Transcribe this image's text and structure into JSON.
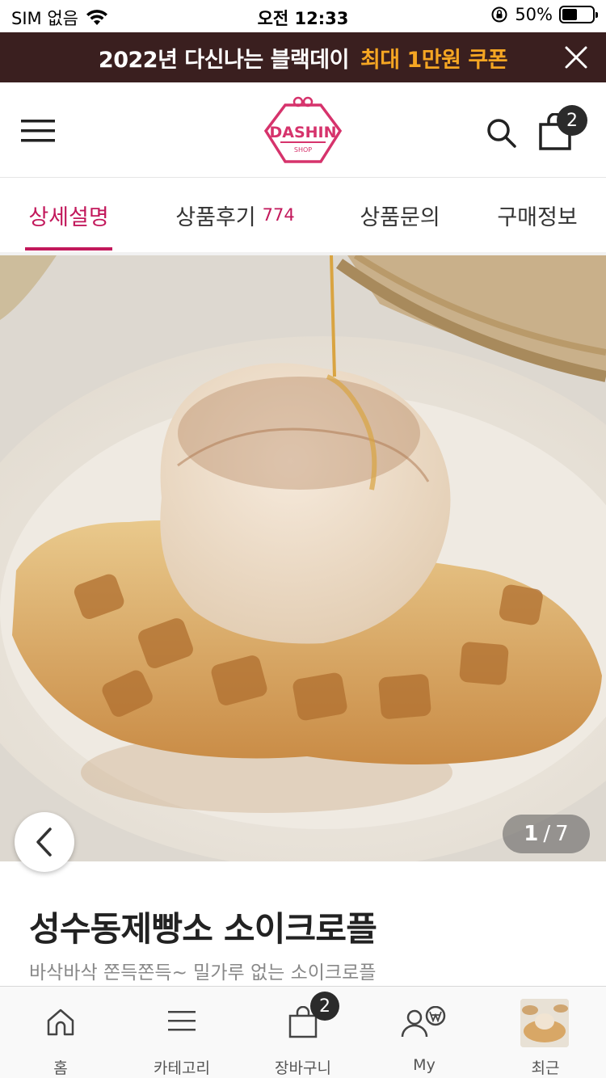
{
  "status_bar": {
    "carrier": "SIM 없음",
    "time": "오전 12:33",
    "battery_percent": "50%",
    "battery_level": 0.5
  },
  "promo": {
    "text": "2022년 다신나는 블랙데이",
    "highlight": "최대 1만원 쿠폰",
    "highlight_color": "#f5a623",
    "background": "#3a1f1f"
  },
  "header": {
    "logo_text": "DASHIN",
    "logo_sub": "SHOP",
    "cart_count": "2",
    "brand_color": "#d6336c"
  },
  "tabs": [
    {
      "label": "상세설명",
      "active": true
    },
    {
      "label": "상품후기",
      "count": "774"
    },
    {
      "label": "상품문의"
    },
    {
      "label": "구매정보"
    }
  ],
  "gallery": {
    "current": "1",
    "separator": "/",
    "total": "7"
  },
  "product": {
    "title": "성수동제빵소 소이크로플",
    "subtitle": "바삭바삭 쫀득쫀득~ 밀가루 없는 소이크로플"
  },
  "bottom_nav": {
    "items": [
      {
        "label": "홈",
        "icon": "home-icon"
      },
      {
        "label": "카테고리",
        "icon": "menu-icon"
      },
      {
        "label": "장바구니",
        "icon": "cart-icon"
      },
      {
        "label": "My",
        "icon": "my-icon"
      },
      {
        "label": "최근",
        "icon": "recent-thumbnail"
      }
    ],
    "cart_badge": "2"
  }
}
